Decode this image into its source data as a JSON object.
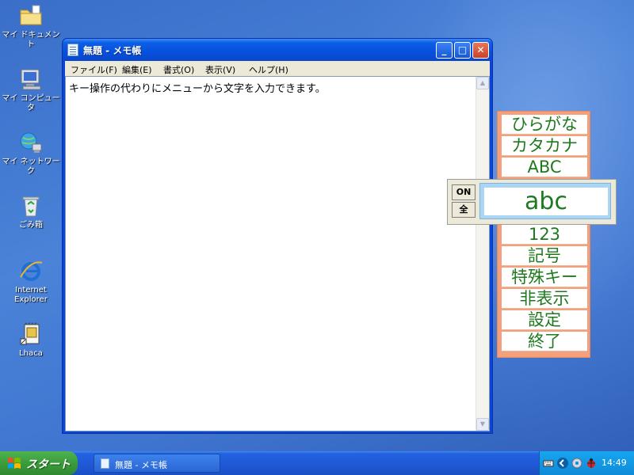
{
  "desktop": {
    "icons": [
      {
        "label": "マイ ドキュメント",
        "icon": "folder-icon"
      },
      {
        "label": "マイ コンピュータ",
        "icon": "computer-icon"
      },
      {
        "label": "マイ ネットワーク",
        "icon": "network-icon"
      },
      {
        "label": "ごみ箱",
        "icon": "recycle-bin-icon"
      },
      {
        "label": "Internet\nExplorer",
        "icon": "internet-explorer-icon"
      },
      {
        "label": "Lhaca",
        "icon": "lhaca-icon"
      }
    ]
  },
  "window": {
    "title": "無題 - メモ帳",
    "controls": {
      "minimize": "_",
      "maximize": "□",
      "close": "✕"
    },
    "menu": [
      "ファイル(F)",
      "編集(E)",
      "書式(O)",
      "表示(V)",
      "ヘルプ(H)"
    ],
    "content": "キー操作の代わりにメニューから文字を入力できます。",
    "scroll": {
      "up": "▲",
      "down": "▼"
    }
  },
  "ime_palette": {
    "items": [
      "ひらがな",
      "カタカナ",
      "ABC",
      "123",
      "記号",
      "特殊キー",
      "非表示",
      "設定",
      "終了"
    ],
    "toolbar": {
      "on_label": "ON",
      "full_label": "全",
      "display": "abc"
    }
  },
  "taskbar": {
    "start_label": "スタート",
    "task_label": "無題 - メモ帳",
    "clock": "14:49"
  },
  "colors": {
    "ime_text": "#1f7a1f",
    "ime_panel": "#f3a07c",
    "titlebar": "#0650dd",
    "start": "#3a9c3a"
  }
}
